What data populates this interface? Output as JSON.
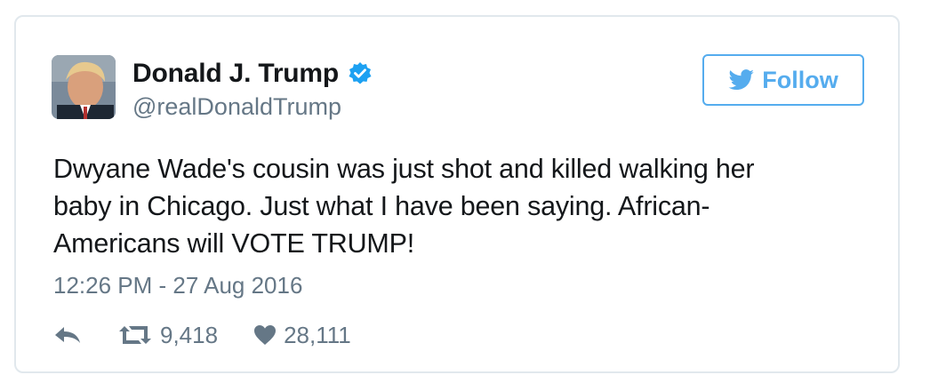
{
  "user": {
    "name": "Donald J. Trump",
    "handle": "@realDonaldTrump"
  },
  "follow_button": {
    "label": "Follow",
    "icon": "twitter-bird-icon"
  },
  "tweet": {
    "text": "Dwyane Wade's cousin was just shot and killed walking her baby in Chicago. Just what I have been saying. African-Americans will VOTE TRUMP!",
    "timestamp": "12:26 PM - 27 Aug 2016"
  },
  "actions": {
    "retweets": "9,418",
    "likes": "28,111"
  },
  "colors": {
    "accent": "#55acee",
    "verified": "#1da1f2",
    "text": "#14171a",
    "muted": "#657786",
    "border": "#e1e8ed"
  }
}
